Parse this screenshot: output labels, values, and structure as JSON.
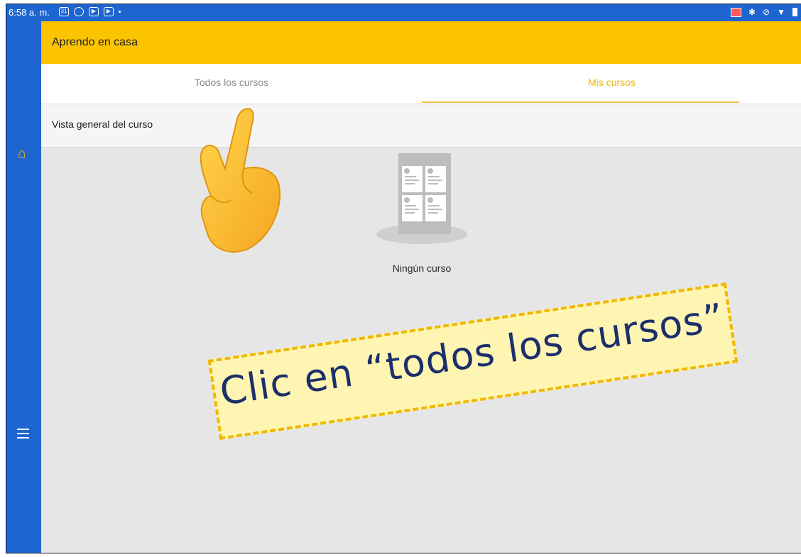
{
  "status_bar": {
    "time": "6:58 a. m.",
    "left_icons": [
      "calendar-icon",
      "circle-app-icon",
      "youtube-icon",
      "youtube-icon",
      "notification-dot-icon"
    ],
    "right_icons": [
      "cast-icon",
      "bluetooth-icon",
      "mute-icon",
      "wifi-icon",
      "battery-icon"
    ]
  },
  "app_bar": {
    "title": "Aprendo en casa"
  },
  "tabs": [
    {
      "label": "Todos los cursos",
      "selected": false
    },
    {
      "label": "Mis cursos",
      "selected": true
    }
  ],
  "overview": {
    "label": "Vista general del curso"
  },
  "empty_state": {
    "message": "Ningún curso",
    "icon": "empty-courses-icon"
  },
  "sidebar": {
    "icons": [
      "home-icon",
      "menu-icon"
    ]
  },
  "callout": {
    "text": "Clic en “todos los cursos”",
    "pointer": "pointing-hand-icon"
  },
  "colors": {
    "primary_blue": "#1f65cf",
    "app_bar_yellow": "#fcc400",
    "selected_tab": "#f0b400",
    "callout_bg": "#fff5b3",
    "callout_text": "#1c2f6b"
  }
}
